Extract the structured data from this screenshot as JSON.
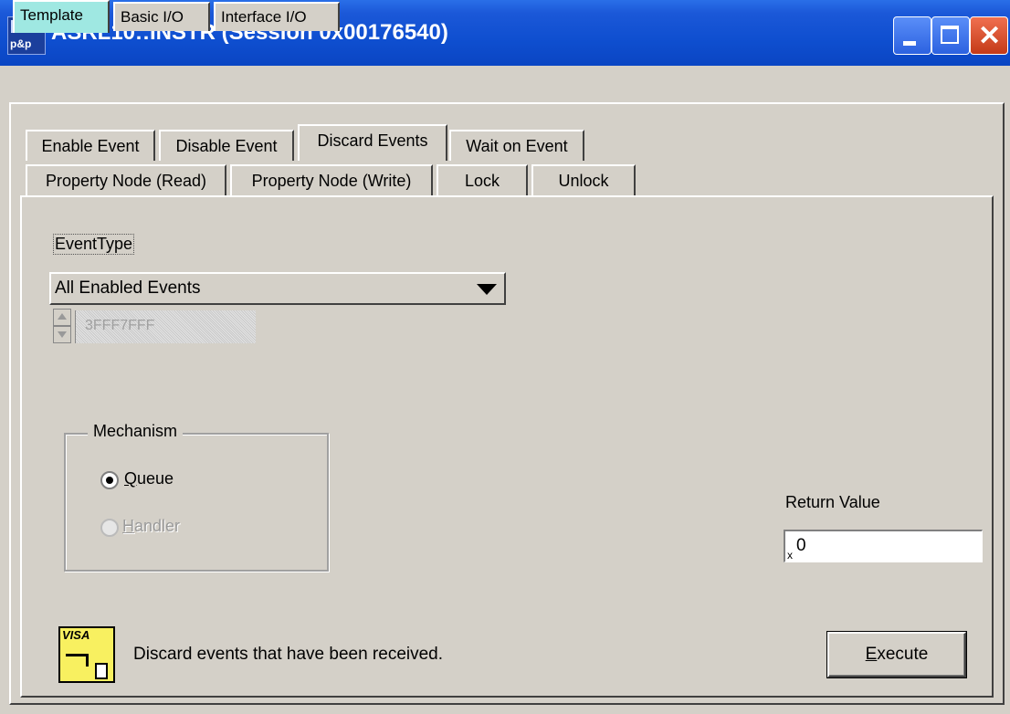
{
  "window": {
    "title": "ASRL10::INSTR (Session 0x00176540)"
  },
  "top_tabs": [
    "Template",
    "Basic I/O",
    "Interface I/O"
  ],
  "sub_tabs_row1": [
    "Enable Event",
    "Disable Event",
    "Discard Events",
    "Wait on Event"
  ],
  "sub_tabs_row2": [
    "Property Node (Read)",
    "Property Node (Write)",
    "Lock",
    "Unlock"
  ],
  "event_type": {
    "label": "EventType",
    "selected": "All Enabled Events",
    "hex_value": "3FFF7FFF"
  },
  "mechanism": {
    "title": "Mechanism",
    "queue_label_first": "Q",
    "queue_label_rest": "ueue",
    "handler_label_first": "H",
    "handler_label_rest": "andler",
    "selected": "Queue"
  },
  "return_value": {
    "label": "Return Value",
    "prefix": "x",
    "value": "0"
  },
  "footer": {
    "icon_text": "VISA",
    "description": "Discard events that have been received.",
    "execute_first": "E",
    "execute_rest": "xecute"
  }
}
